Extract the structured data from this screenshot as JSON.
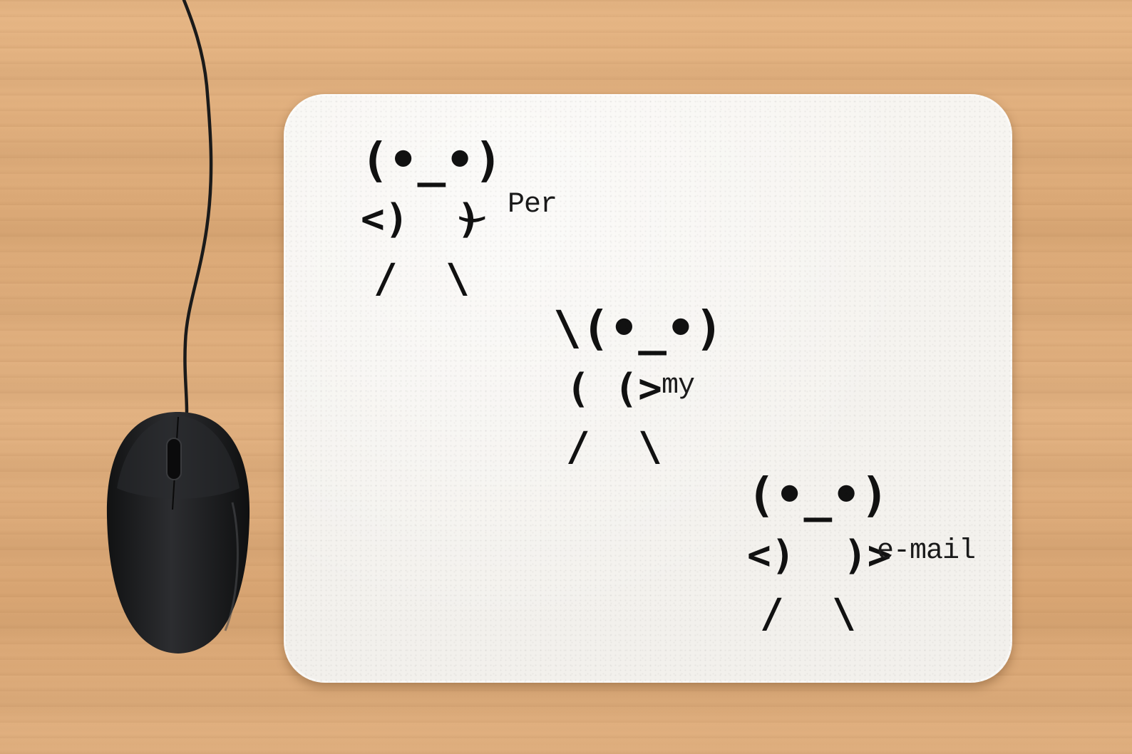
{
  "pad": {
    "figure_1": {
      "head": "(•_•)",
      "body": "<)  )",
      "arm": "‿",
      "legs": "/  \\",
      "label": "Per"
    },
    "figure_2": {
      "head": "\\(•_•)",
      "body": "( (>",
      "legs": "/  \\",
      "label": "my"
    },
    "figure_3": {
      "head": "(•_•)",
      "body": "<)  )>",
      "legs": "/  \\",
      "label": "e-mail"
    }
  },
  "colors": {
    "desk": "#deae7c",
    "pad": "#f4f2ee",
    "ink": "#111111",
    "mouse": "#1e1f21"
  }
}
